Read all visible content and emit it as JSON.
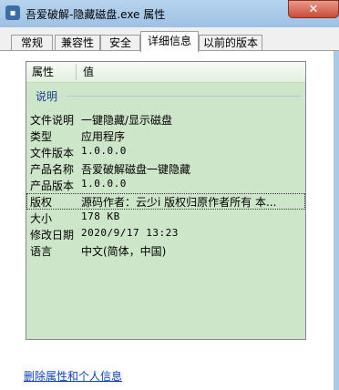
{
  "window": {
    "title": "吾爱破解-隐藏磁盘.exe 属性",
    "close_glyph": "✕"
  },
  "tabs": [
    {
      "label": "常规"
    },
    {
      "label": "兼容性"
    },
    {
      "label": "安全"
    },
    {
      "label": "详细信息",
      "active": true
    },
    {
      "label": "以前的版本"
    }
  ],
  "list": {
    "col_property": "属性",
    "col_value": "值",
    "group": "说明",
    "rows": [
      {
        "k": "文件说明",
        "v": "一键隐藏/显示磁盘"
      },
      {
        "k": "类型",
        "v": "应用程序"
      },
      {
        "k": "文件版本",
        "v": "1.0.0.0"
      },
      {
        "k": "产品名称",
        "v": "吾爱破解磁盘一键隐藏"
      },
      {
        "k": "产品版本",
        "v": "1.0.0.0"
      },
      {
        "k": "版权",
        "v": "源码作者：云少i 版权归原作者所有 本..."
      },
      {
        "k": "大小",
        "v": "178 KB"
      },
      {
        "k": "修改日期",
        "v": "2020/9/17 13:23"
      },
      {
        "k": "语言",
        "v": "中文(简体，中国)"
      }
    ]
  },
  "footer": {
    "link": "删除属性和个人信息"
  },
  "colors": {
    "list_bg": "#cde5c8",
    "link": "#0b3fb8",
    "close": "#c74b3a"
  }
}
